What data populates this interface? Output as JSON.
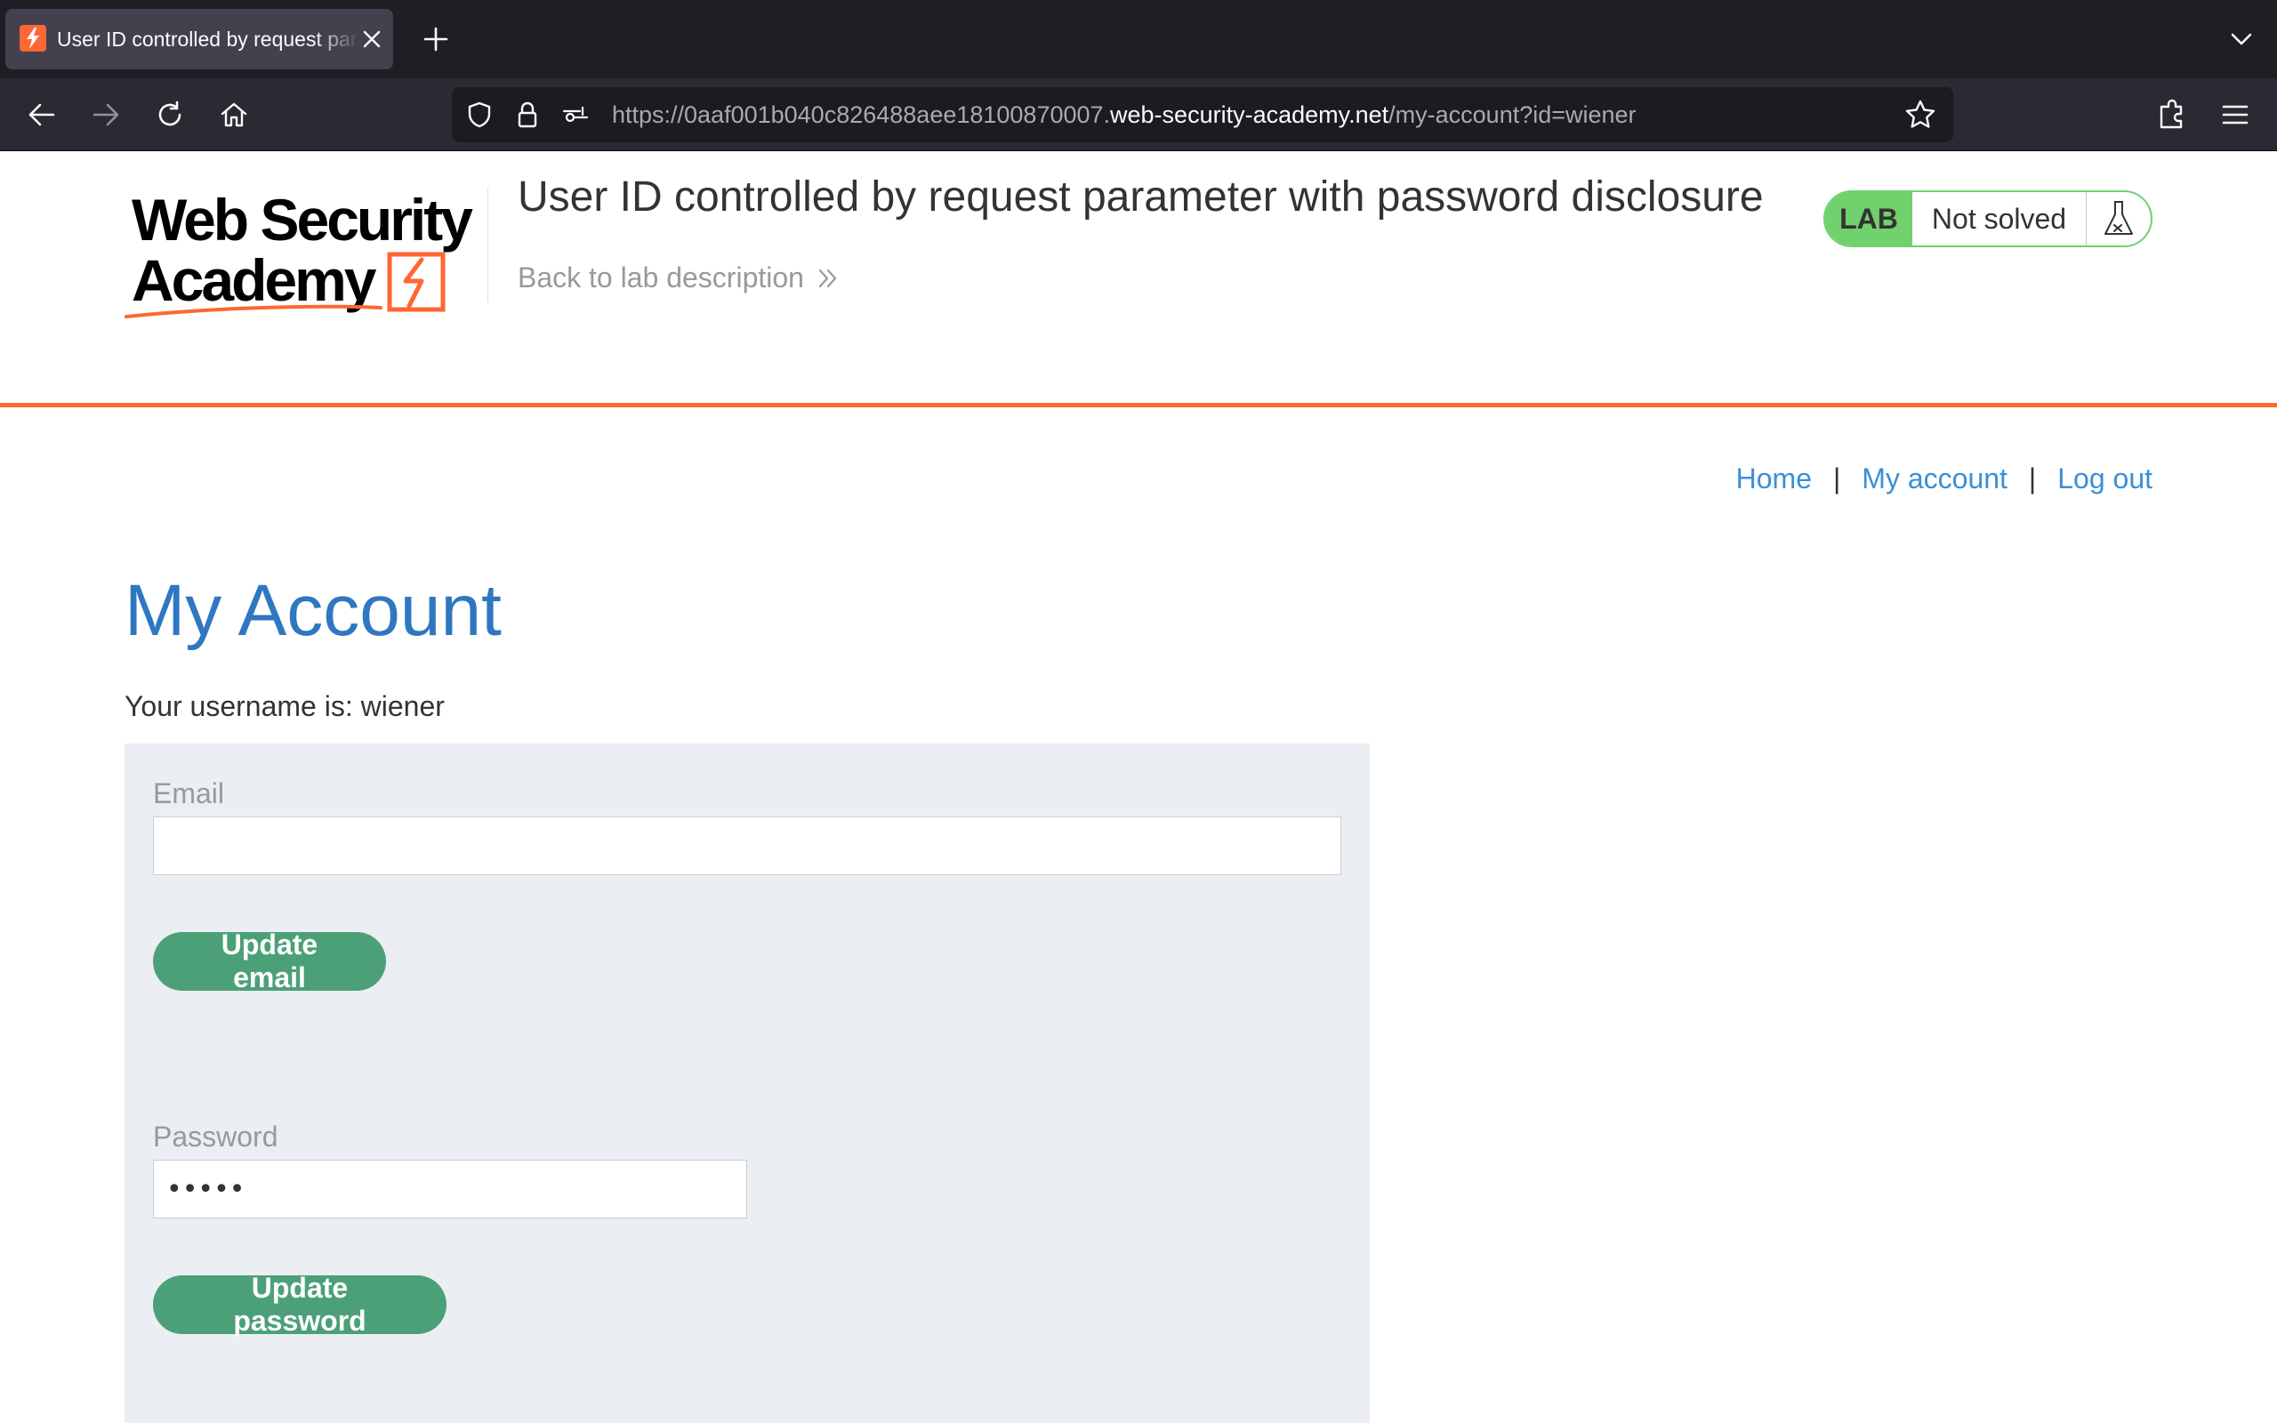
{
  "browser": {
    "tab_title": "User ID controlled by request parameter with password disclosure",
    "url_prefix": "https://0aaf001b040c826488aee18100870007.",
    "url_host": "web-security-academy.net",
    "url_path": "/my-account?id=wiener"
  },
  "header": {
    "logo_text": "Web Security Academy",
    "lab_title": "User ID controlled by request parameter with password disclosure",
    "back_link": "Back to lab description",
    "lab_tag": "LAB",
    "lab_status": "Not solved"
  },
  "nav": {
    "home": "Home",
    "separator": "|",
    "my_account": "My account",
    "log_out": "Log out"
  },
  "main": {
    "heading": "My Account",
    "username_line": "Your username is: wiener",
    "email_label": "Email",
    "email_value": "",
    "update_email_button": "Update email",
    "password_label": "Password",
    "password_value": "peter",
    "update_password_button": "Update password"
  },
  "colors": {
    "accent_orange": "#ff6633",
    "link_blue": "#3b8fd6",
    "heading_blue": "#2f77c0",
    "lab_green": "#70d16d",
    "button_green": "#4ca078",
    "panel_bg": "#ebeef2"
  },
  "icons": [
    "back-arrow-icon",
    "forward-arrow-icon",
    "reload-icon",
    "home-icon",
    "shield-icon",
    "lock-icon",
    "permissions-icon",
    "star-icon",
    "extensions-icon",
    "menu-icon",
    "flask-icon",
    "double-chevron-right-icon"
  ]
}
